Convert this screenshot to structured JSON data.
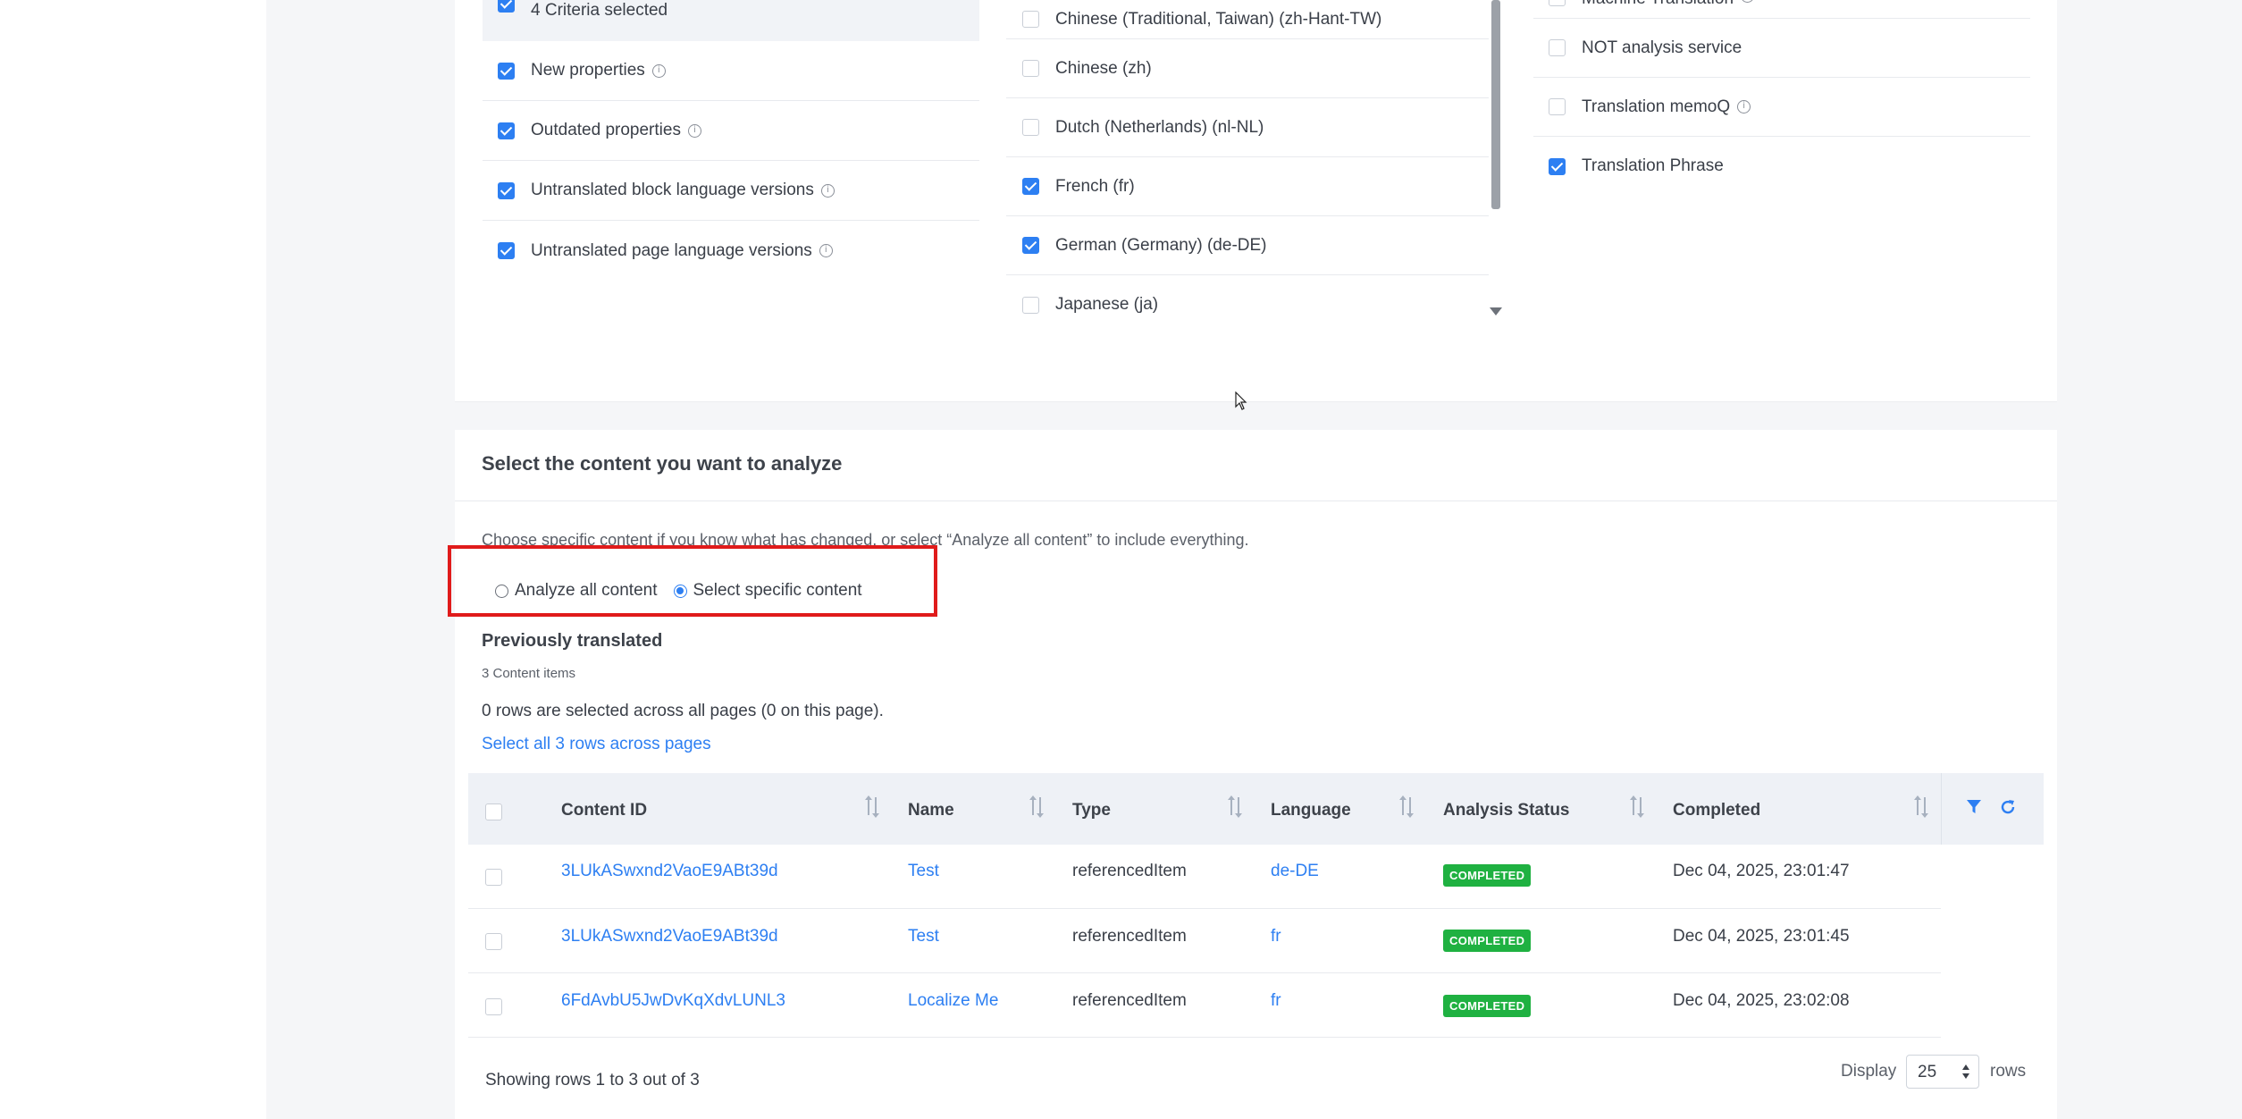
{
  "criteria": {
    "selected_summary": "4 Criteria selected",
    "items": [
      {
        "label": "New properties",
        "checked": true,
        "info": true
      },
      {
        "label": "Outdated properties",
        "checked": true,
        "info": true
      },
      {
        "label": "Untranslated block language versions",
        "checked": true,
        "info": true
      },
      {
        "label": "Untranslated page language versions",
        "checked": true,
        "info": true
      }
    ]
  },
  "languages": {
    "items": [
      {
        "label": "Chinese (Traditional, Taiwan) (zh-Hant-TW)",
        "checked": false
      },
      {
        "label": "Chinese (zh)",
        "checked": false
      },
      {
        "label": "Dutch (Netherlands) (nl-NL)",
        "checked": false
      },
      {
        "label": "French (fr)",
        "checked": true
      },
      {
        "label": "German (Germany) (de-DE)",
        "checked": true
      },
      {
        "label": "Japanese (ja)",
        "checked": false
      }
    ]
  },
  "services": {
    "items": [
      {
        "label": "Machine Translation",
        "checked": false,
        "info": true
      },
      {
        "label": "NOT analysis service",
        "checked": false,
        "info": false
      },
      {
        "label": "Translation memoQ",
        "checked": false,
        "info": true
      },
      {
        "label": "Translation Phrase",
        "checked": true,
        "info": false
      }
    ]
  },
  "content_section": {
    "title": "Select the content you want to analyze",
    "description": "Choose specific content if you know what has changed, or select “Analyze all content” to include everything.",
    "options": [
      {
        "label": "Analyze all content",
        "selected": false
      },
      {
        "label": "Select specific content",
        "selected": true
      }
    ],
    "previously_translated": "Previously translated",
    "items_count": "3 Content items",
    "selection_info": "0 rows are selected across all pages (0 on this page).",
    "select_all_link": "Select all 3 rows across pages"
  },
  "table": {
    "columns": [
      "Content ID",
      "Name",
      "Type",
      "Language",
      "Analysis Status",
      "Completed"
    ],
    "rows": [
      {
        "content_id": "3LUkASwxnd2VaoE9ABt39d",
        "name": "Test",
        "type": "referencedItem",
        "language": "de-DE",
        "status": "COMPLETED",
        "completed": "Dec 04, 2025, 23:01:47"
      },
      {
        "content_id": "3LUkASwxnd2VaoE9ABt39d",
        "name": "Test",
        "type": "referencedItem",
        "language": "fr",
        "status": "COMPLETED",
        "completed": "Dec 04, 2025, 23:01:45"
      },
      {
        "content_id": "6FdAvbU5JwDvKqXdvLUNL3",
        "name": "Localize Me",
        "type": "referencedItem",
        "language": "fr",
        "status": "COMPLETED",
        "completed": "Dec 04, 2025, 23:02:08"
      }
    ],
    "footer": {
      "showing": "Showing rows 1 to 3 out of 3",
      "display_label": "Display",
      "rows_value": "25",
      "rows_label": "rows"
    }
  },
  "colors": {
    "accent": "#2d7ff2",
    "status_completed": "#1fb141",
    "highlight_box": "#e01b1b"
  }
}
